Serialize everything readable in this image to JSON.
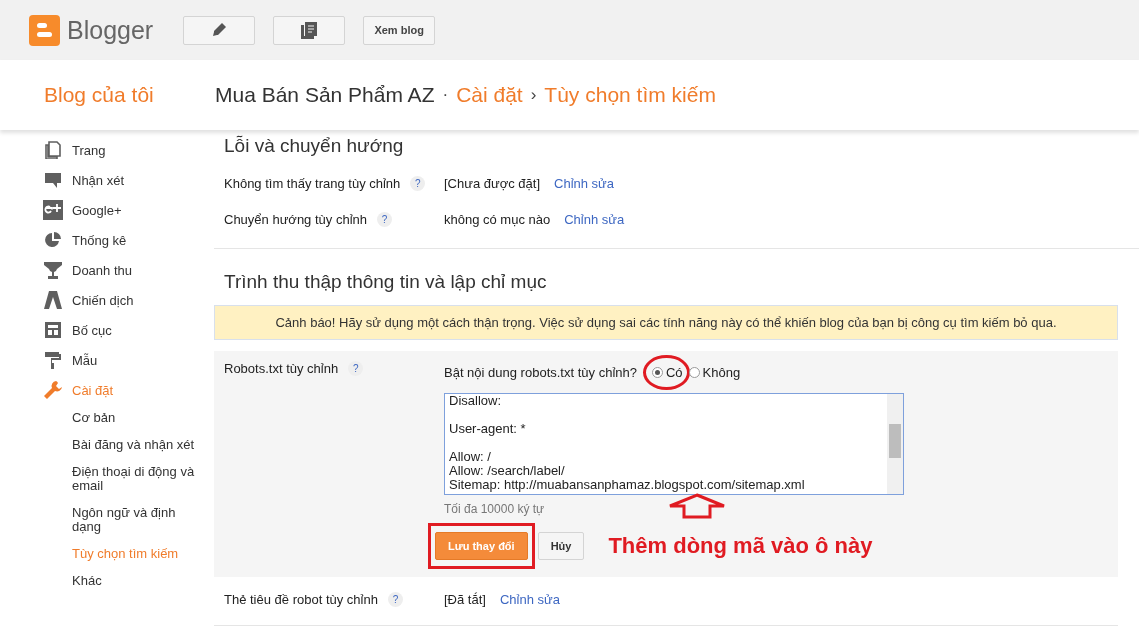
{
  "top_bar": {
    "logo_text": "Blogger",
    "view_blog_button": "Xem blog"
  },
  "header": {
    "my_blogs": "Blog của tôi",
    "blog_name": "Mua Bán Sản Phẩm AZ",
    "separator": "·",
    "crumbs": [
      {
        "label": "Cài đặt",
        "chevron": "›"
      },
      {
        "label": "Tùy chọn tìm kiếm"
      }
    ]
  },
  "sidebar": {
    "items": [
      {
        "label": "Trang",
        "selected": false
      },
      {
        "label": "Nhận xét",
        "selected": false
      },
      {
        "label": "Google+",
        "selected": false
      },
      {
        "label": "Thống kê",
        "selected": false
      },
      {
        "label": "Doanh thu",
        "selected": false
      },
      {
        "label": "Chiến dịch",
        "selected": false
      },
      {
        "label": "Bố cục",
        "selected": false
      },
      {
        "label": "Mẫu",
        "selected": false
      },
      {
        "label": "Cài đặt",
        "selected": true,
        "children": [
          {
            "label": "Cơ bản",
            "selected": false
          },
          {
            "label": "Bài đăng và nhận xét",
            "selected": false
          },
          {
            "label": "Điện thoại di động và email",
            "selected": false
          },
          {
            "label": "Ngôn ngữ và định dạng",
            "selected": false
          },
          {
            "label": "Tùy chọn tìm kiếm",
            "selected": true
          },
          {
            "label": "Khác",
            "selected": false
          }
        ]
      }
    ]
  },
  "errors_section": {
    "title": "Lỗi và chuyển hướng",
    "rows": [
      {
        "label": "Không tìm thấy trang tùy chỉnh",
        "help": "?",
        "value": "[Chưa được đặt]",
        "link": "Chỉnh sửa"
      },
      {
        "label": "Chuyển hướng tùy chỉnh",
        "help": "?",
        "value": "không có mục nào",
        "link": "Chỉnh sửa"
      }
    ]
  },
  "crawl_section": {
    "title": "Trình thu thập thông tin và lập chỉ mục",
    "warning": "Cảnh báo! Hãy sử dụng một cách thận trọng. Việc sử dụng sai các tính năng này có thể khiến blog của bạn bị công cụ tìm kiếm bỏ qua.",
    "robots": {
      "label": "Robots.txt tùy chỉnh",
      "help": "?",
      "question": "Bật nội dung robots.txt tùy chỉnh?",
      "options": [
        {
          "label": "Có",
          "selected": true
        },
        {
          "label": "Không",
          "selected": false
        }
      ],
      "line_groups": [
        [
          "Disallow:"
        ],
        [
          "User-agent: *"
        ],
        [
          "Allow: /",
          "Allow: /search/label/",
          "Sitemap: http://muabansanphamaz.blogspot.com/sitemap.xml"
        ]
      ],
      "hint": "Tối đa 10000 ký tự",
      "save_button": "Lưu thay đổi",
      "cancel_button": "Hủy"
    },
    "rows": [
      {
        "label": "Thẻ tiêu đề robot tùy chỉnh",
        "help": "?",
        "value": "[Đã tắt]",
        "link": "Chỉnh sửa"
      }
    ]
  },
  "annotation": {
    "text": "Thêm dòng mã vào ô này"
  }
}
